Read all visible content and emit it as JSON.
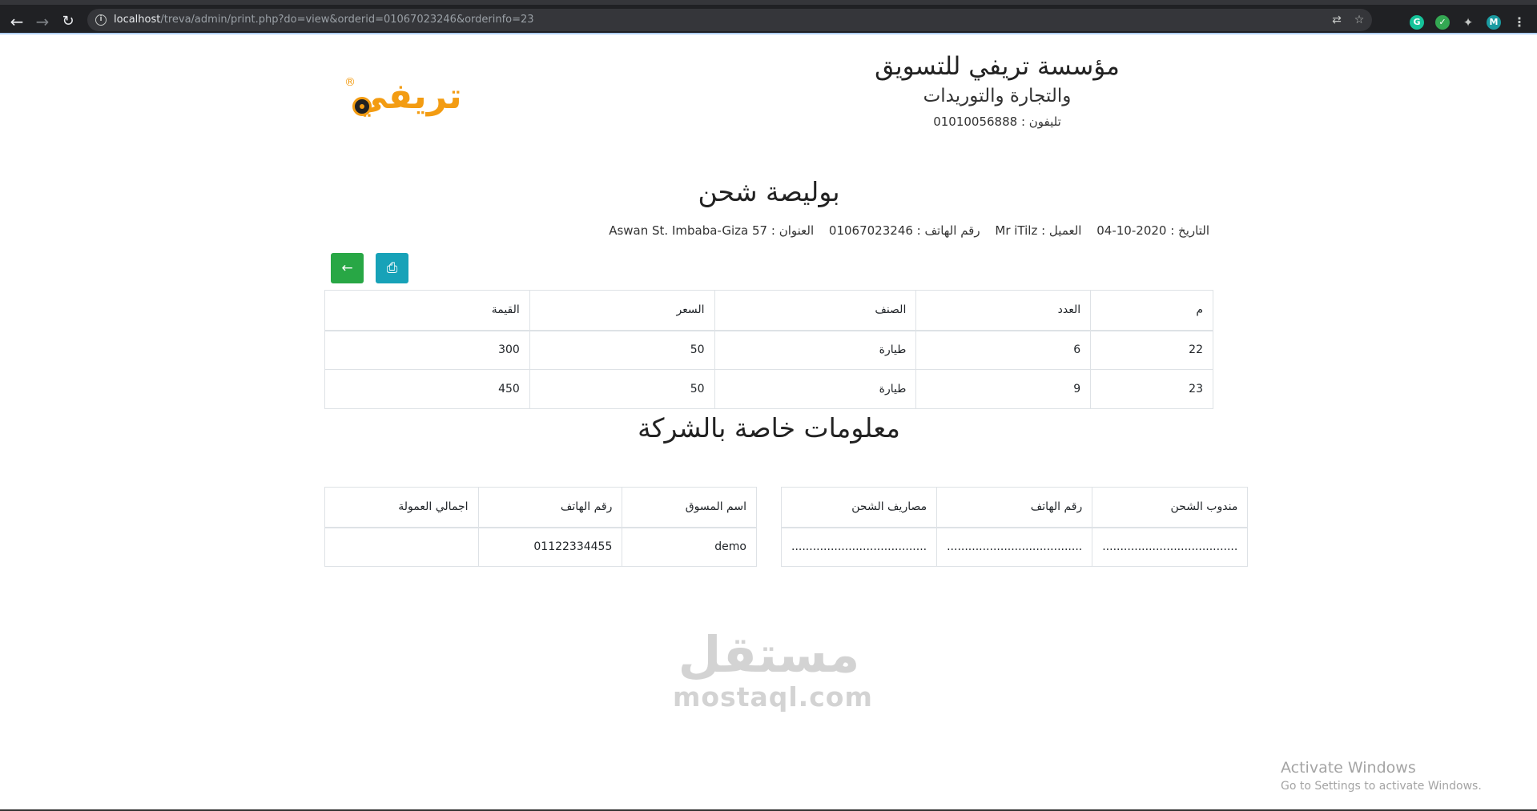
{
  "browser": {
    "url_host": "localhost",
    "url_path": "/treva/admin/print.php?do=view&orderid=01067023246&orderinfo=23",
    "profile_initial": "M",
    "grammarly_initial": "G"
  },
  "company": {
    "name": "مؤسسة تريفي للتسويق",
    "subtitle": "والتجارة والتوريدات",
    "phone": "تليفون : 01010056888",
    "logo_text": "تريفي",
    "logo_mark": "®"
  },
  "document": {
    "title": "بوليصة شحن",
    "date": "التاريخ : 2020-10-04",
    "customer": "العميل : Mr iTilz",
    "phone": "رقم الهاتف : 01067023246",
    "address": "العنوان : 57 Aswan St. Imbaba-Giza"
  },
  "buttons": {
    "back_icon": "←",
    "print_icon": "⎙"
  },
  "items_table": {
    "headers": [
      "م",
      "العدد",
      "الصنف",
      "السعر",
      "القيمة"
    ],
    "rows": [
      [
        "22",
        "6",
        "طيارة",
        "50",
        "300"
      ],
      [
        "23",
        "9",
        "طيارة",
        "50",
        "450"
      ]
    ]
  },
  "company_info": {
    "title": "معلومات خاصة بالشركة",
    "shipping_headers": [
      "مندوب الشحن",
      "رقم الهاتف",
      "مصاريف الشحن"
    ],
    "shipping_row": [
      "......................................",
      "......................................",
      "......................................"
    ],
    "marketing_headers": [
      "اسم المسوق",
      "رقم الهاتف",
      "اجمالي العمولة"
    ],
    "marketing_row": [
      "demo",
      "01122334455",
      ""
    ]
  },
  "watermark": {
    "arabic": "مستقل",
    "latin": "mostaql.com"
  },
  "windows": {
    "title": "Activate Windows",
    "subtitle": "Go to Settings to activate Windows."
  },
  "colors": {
    "back_button": "#28a745",
    "print_button": "#17a2b8",
    "logo": "#f39c12"
  }
}
